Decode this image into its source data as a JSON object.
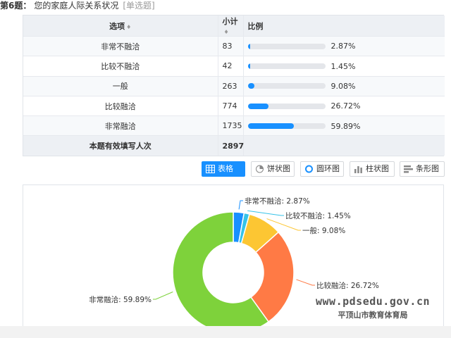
{
  "question": {
    "number": "第6题：",
    "text": "您的家庭人际关系状况",
    "type": "[单选题]"
  },
  "table": {
    "headers": {
      "option": "选项",
      "count": "小计",
      "ratio": "比例"
    },
    "rows": [
      {
        "option": "非常不融洽",
        "count": "83",
        "percent": "2.87%",
        "fraction": 0.0287
      },
      {
        "option": "比较不融洽",
        "count": "42",
        "percent": "1.45%",
        "fraction": 0.0145
      },
      {
        "option": "一般",
        "count": "263",
        "percent": "9.08%",
        "fraction": 0.0908
      },
      {
        "option": "比较融洽",
        "count": "774",
        "percent": "26.72%",
        "fraction": 0.2672
      },
      {
        "option": "非常融洽",
        "count": "1735",
        "percent": "59.89%",
        "fraction": 0.5989
      }
    ],
    "total_label": "本题有效填写人次",
    "total_value": "2897"
  },
  "toolbar": {
    "buttons": [
      {
        "label": "表格",
        "icon": "table-icon",
        "active": true
      },
      {
        "label": "饼状图",
        "icon": "pie-chart-icon",
        "active": false
      },
      {
        "label": "圆环图",
        "icon": "donut-chart-icon",
        "active": false
      },
      {
        "label": "柱状图",
        "icon": "bar-chart-icon",
        "active": false
      },
      {
        "label": "条形图",
        "icon": "horizontal-bar-chart-icon",
        "active": false
      }
    ]
  },
  "chart_data": {
    "type": "pie",
    "variant": "donut",
    "categories": [
      "非常不融洽",
      "比较不融洽",
      "一般",
      "比较融洽",
      "非常融洽"
    ],
    "values": [
      2.87,
      1.45,
      9.08,
      26.72,
      59.89
    ],
    "labels": [
      "非常不融洽: 2.87%",
      "比较不融洽: 1.45%",
      "一般: 9.08%",
      "比较融洽: 26.72%",
      "非常融洽: 59.89%"
    ],
    "colors": [
      "#1890ff",
      "#35c3e8",
      "#fcc633",
      "#ff7a45",
      "#7ed23b"
    ]
  },
  "watermark": {
    "url": "www.pdsedu.gov.cn",
    "org": "平顶山市教育体育局"
  },
  "colors": {
    "accent": "#1890ff",
    "bar_track": "#e4e6ea"
  }
}
